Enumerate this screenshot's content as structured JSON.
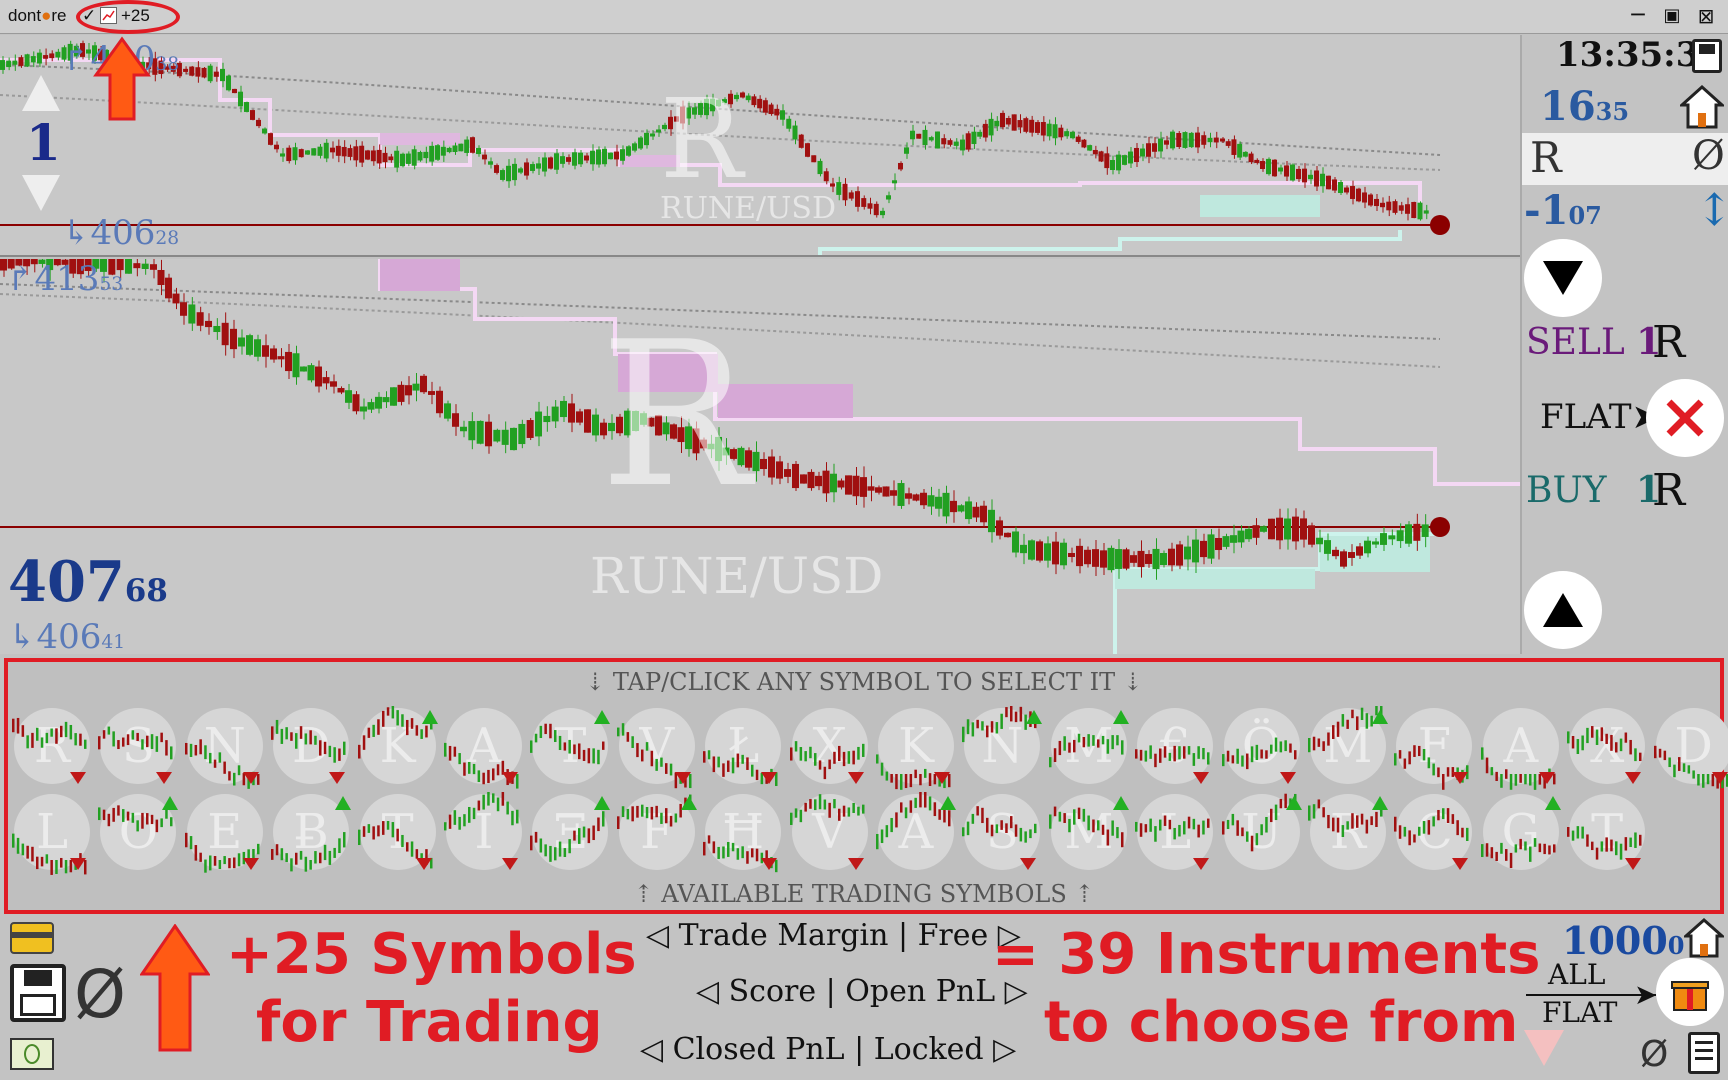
{
  "titlebar": {
    "app_name": "dont",
    "app_name_suffix": "re",
    "check": "✓",
    "badge": "+25"
  },
  "top_chart": {
    "high_label": "430",
    "high_frac": "38",
    "low_label": "406",
    "low_frac": "28",
    "step_value": "1",
    "watermark_letter": "R",
    "watermark_symbol": "RUNE/USD"
  },
  "main_chart": {
    "high_label": "413",
    "high_frac": "53",
    "price_label": "407",
    "price_frac": "68",
    "low_label": "406",
    "low_frac": "41",
    "watermark_letter": "R",
    "watermark_symbol": "RUNE/USD"
  },
  "right_panel": {
    "clock": "13:35:31",
    "count_main": "16",
    "count_frac": "35",
    "symbol": "R",
    "null_symbol": "Ø",
    "change_main": "-1",
    "change_frac": "07",
    "sell_label": "SELL",
    "sell_qty": "1",
    "sell_sym": "R",
    "flat_label": "FLAT",
    "buy_label": "BUY",
    "buy_qty": "1",
    "buy_sym": "R"
  },
  "symbols_panel": {
    "header_top": "⇣ TAP/CLICK ANY SYMBOL TO SELECT IT ⇣",
    "header_bottom": "⇡ AVAILABLE TRADING SYMBOLS ⇡",
    "row1": [
      "R",
      "S",
      "N",
      "D",
      "K",
      "A",
      "T",
      "V",
      "Ł",
      "X",
      "K",
      "N",
      "M",
      "€",
      "Ö",
      "M",
      "F",
      "A",
      "X",
      "D"
    ],
    "row2": [
      "L",
      "O",
      "E",
      "Ƀ",
      "T",
      "I",
      "Ξ",
      "F",
      "Ħ",
      "V",
      "A",
      "S",
      "M",
      "L",
      "U",
      "R",
      "C",
      "G",
      "T"
    ]
  },
  "bottom": {
    "null_symbol": "Ø",
    "promo_line1": "+25  Symbols",
    "promo_line2": "for  Trading",
    "trade_margin": "◁ Trade Margin | Free ▷",
    "score": "◁ Score | Open PnL ▷",
    "closed": "◁ Closed PnL | Locked ▷",
    "promo_line3": "= 39  Instruments",
    "promo_line4": "to choose from",
    "balance_main": "1000",
    "balance_frac": "0",
    "all_label": "ALL",
    "flat_label": "FLAT",
    "null_small": "Ø"
  },
  "colors": {
    "accent_red": "#e01c24",
    "candle_up": "#22a022",
    "candle_down": "#a01010",
    "price_line": "#8b0000",
    "label_blue": "#5a7ab8",
    "dark_blue": "#1a2a8a",
    "sell_purple": "#6a1a7a",
    "buy_teal": "#1a6a6a"
  }
}
